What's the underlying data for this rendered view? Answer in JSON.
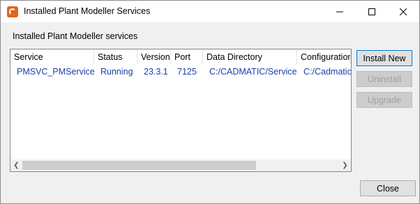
{
  "window": {
    "title": "Installed Plant Modeller Services",
    "controls": {
      "minimize_icon": "minimize-icon",
      "maximize_icon": "maximize-icon",
      "close_icon": "close-icon"
    }
  },
  "group_label": "Installed Plant Modeller services",
  "table": {
    "columns": [
      "Service",
      "Status",
      "Version",
      "Port",
      "Data Directory",
      "Configuration"
    ],
    "rows": [
      [
        "PMSVC_PMService",
        "Running",
        "23.3.1",
        "7125",
        "C:/CADMATIC/Services",
        "C:/Cadmatic/c"
      ]
    ],
    "row_color": "#1a3fa8"
  },
  "buttons": {
    "install_new": "Install New",
    "uninstall": "Uninstall",
    "upgrade": "Upgrade",
    "close": "Close"
  },
  "colors": {
    "app_icon": "#e0661f",
    "default_button_border": "#0078d7"
  }
}
